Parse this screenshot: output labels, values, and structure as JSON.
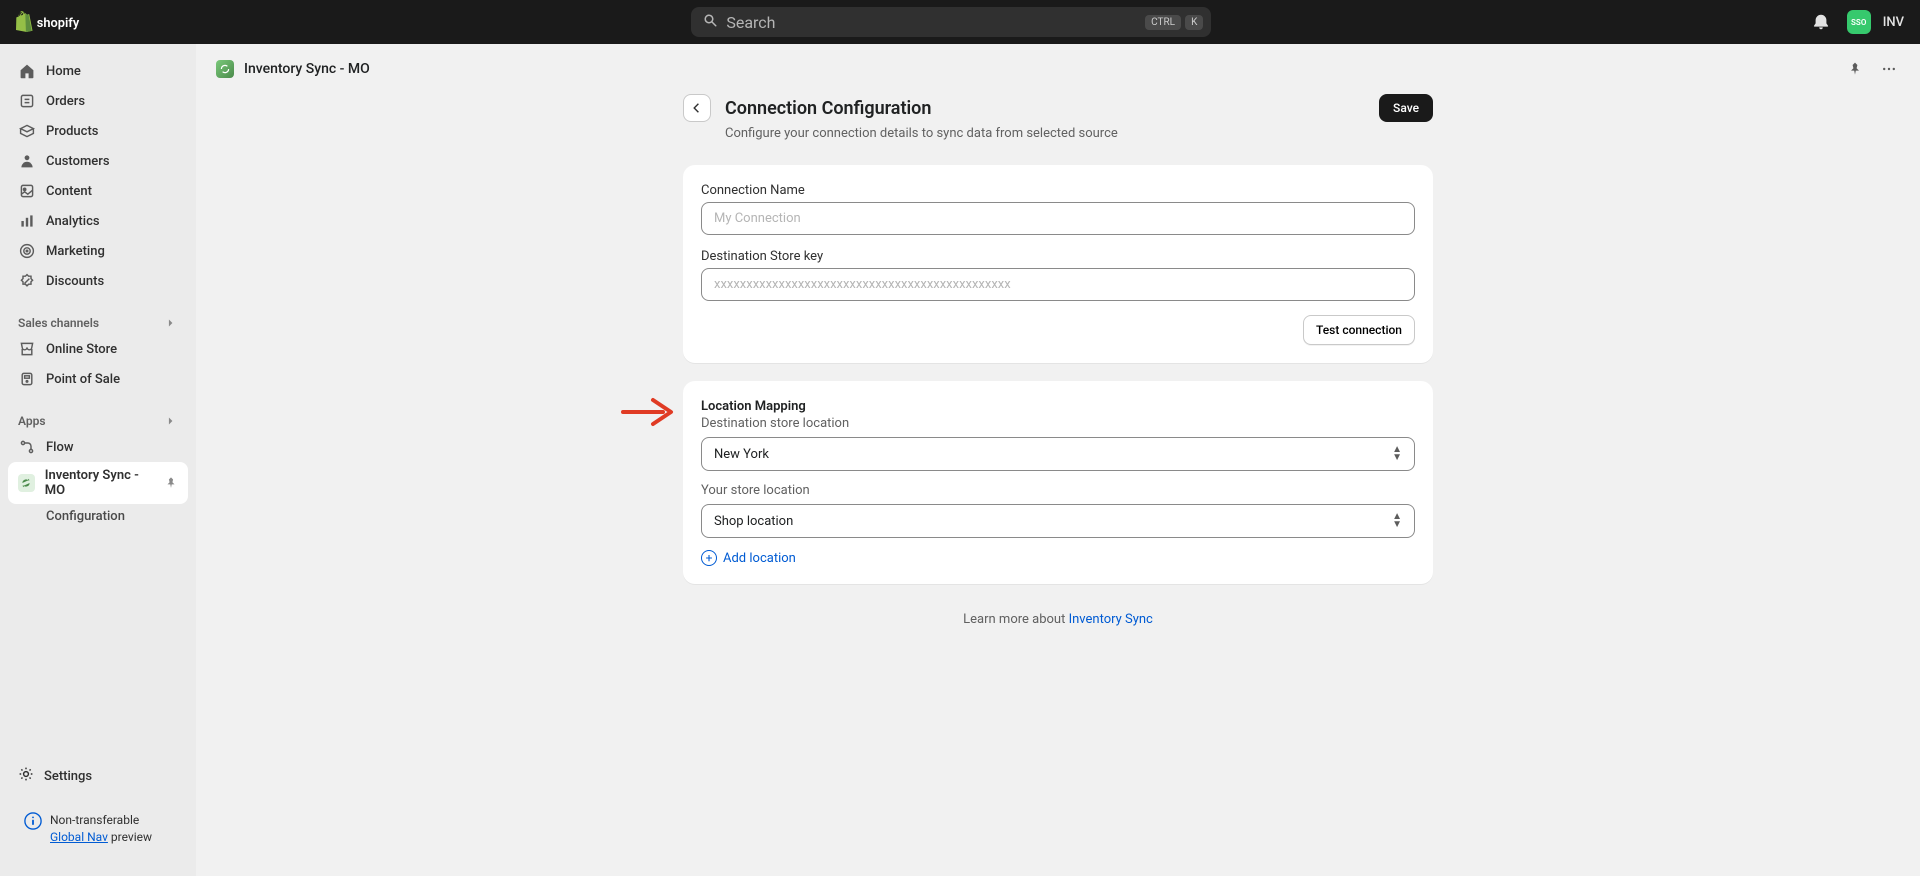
{
  "topbar": {
    "search_placeholder": "Search",
    "kbd1": "CTRL",
    "kbd2": "K",
    "avatar_abbr": "SSO",
    "store_abbr": "INV"
  },
  "sidebar": {
    "home": "Home",
    "orders": "Orders",
    "products": "Products",
    "customers": "Customers",
    "content": "Content",
    "analytics": "Analytics",
    "marketing": "Marketing",
    "discounts": "Discounts",
    "sales_channels": "Sales channels",
    "online_store": "Online Store",
    "point_of_sale": "Point of Sale",
    "apps": "Apps",
    "flow": "Flow",
    "inventory_sync": "Inventory Sync - MO",
    "configuration": "Configuration",
    "settings": "Settings",
    "preview_line1": "Non-transferable",
    "preview_link": "Global Nav",
    "preview_line2": " preview"
  },
  "page": {
    "breadcrumb": "Inventory Sync - MO",
    "title": "Connection Configuration",
    "subtitle": "Configure your connection details to sync data from selected source",
    "save": "Save"
  },
  "form": {
    "connection_name_label": "Connection Name",
    "connection_name_placeholder": "My Connection",
    "dest_key_label": "Destination Store key",
    "dest_key_placeholder": "xxxxxxxxxxxxxxxxxxxxxxxxxxxxxxxxxxxxxxxxxxxxxx",
    "test_connection": "Test connection"
  },
  "mapping": {
    "title": "Location Mapping",
    "dest_label": "Destination store location",
    "dest_value": "New York",
    "your_label": "Your store location",
    "your_value": "Shop location",
    "add_location": "Add location"
  },
  "footer": {
    "learn_prefix": "Learn more about ",
    "learn_link": "Inventory Sync"
  },
  "colors": {
    "accent": "#005bd3",
    "topbar": "#1a1a1a",
    "avatar": "#36c96d",
    "arrow": "#e03b24"
  }
}
